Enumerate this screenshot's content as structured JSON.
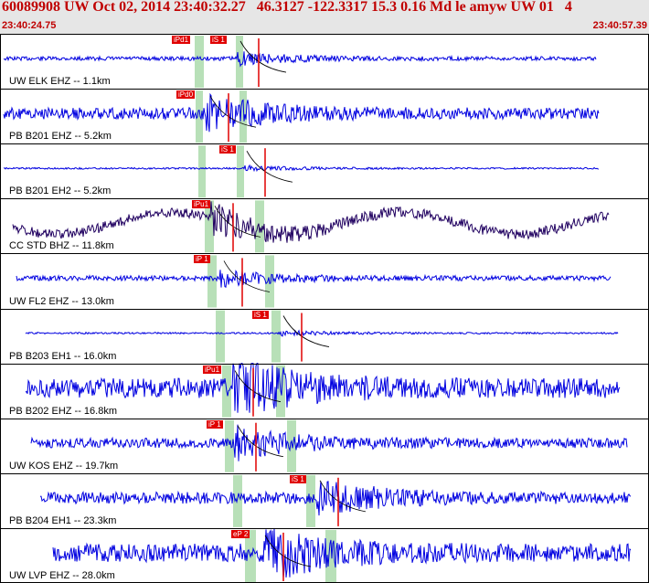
{
  "header": {
    "title": "60089908 UW Oct 02, 2014 23:40:32.27   46.3127 -122.3317 15.3 0.16 Md le amyw UW 01   4",
    "time_start": "23:40:24.75",
    "time_end": "23:40:57.39"
  },
  "colors": {
    "header_bg": "#e6e6e6",
    "title_text": "#c00000",
    "trace_blue": "#0000e0",
    "trace_dark": "#200060",
    "pick_red": "#e00000",
    "window_green": "#b8e0b8"
  },
  "traces": [
    {
      "label": "UW ELK EHZ -- 1.1km",
      "color": "blue",
      "amp": 0.12,
      "picks": [
        {
          "tag": "iPd1"
        },
        {
          "tag": "iS 1"
        }
      ]
    },
    {
      "label": "PB B201 EHZ -- 5.2km",
      "color": "blue",
      "amp": 0.35,
      "picks": [
        {
          "tag": "iPd0"
        }
      ]
    },
    {
      "label": "PB B201 EH2 -- 5.2km",
      "color": "blue",
      "amp": 0.05,
      "picks": [
        {
          "tag": "iS 1"
        }
      ]
    },
    {
      "label": "CC STD BHZ -- 11.8km",
      "color": "dark",
      "amp": 0.3,
      "picks": [
        {
          "tag": "iPu1"
        }
      ]
    },
    {
      "label": "UW FL2 EHZ -- 13.0km",
      "color": "blue",
      "amp": 0.15,
      "picks": [
        {
          "tag": "iP 1"
        }
      ]
    },
    {
      "label": "PB B203 EH1 -- 16.0km",
      "color": "blue",
      "amp": 0.05,
      "picks": [
        {
          "tag": "iS 1"
        }
      ]
    },
    {
      "label": "PB B202 EHZ -- 16.8km",
      "color": "blue",
      "amp": 0.6,
      "picks": [
        {
          "tag": "iPu1"
        }
      ]
    },
    {
      "label": "UW KOS EHZ -- 19.7km",
      "color": "blue",
      "amp": 0.3,
      "picks": [
        {
          "tag": "iP 1"
        }
      ]
    },
    {
      "label": "PB B204 EH1 -- 23.3km",
      "color": "blue",
      "amp": 0.35,
      "picks": [
        {
          "tag": "iS 1"
        }
      ]
    },
    {
      "label": "UW LVP EHZ -- 28.0km",
      "color": "blue",
      "amp": 0.55,
      "picks": [
        {
          "tag": "eP 2"
        }
      ]
    }
  ]
}
